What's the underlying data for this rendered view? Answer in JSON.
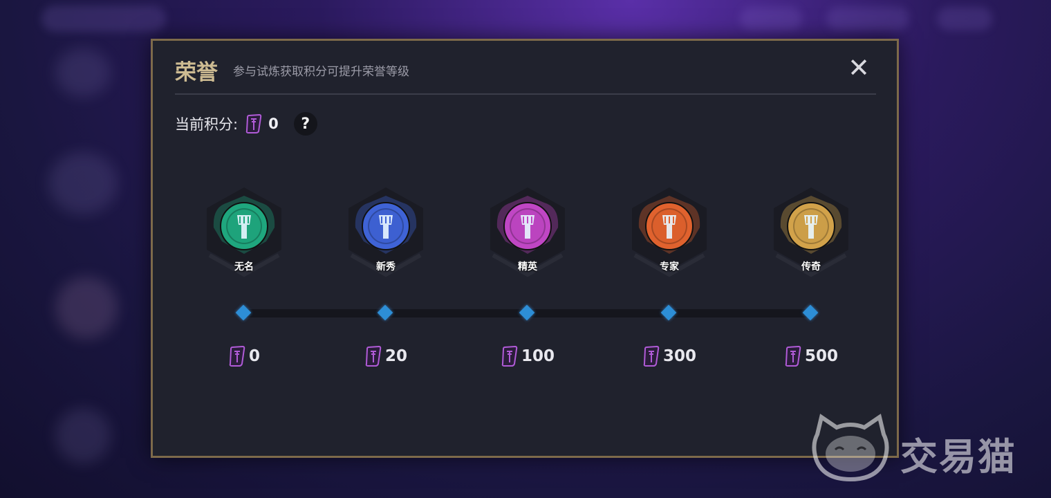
{
  "dialog": {
    "title": "荣誉",
    "subtitle": "参与试炼获取积分可提升荣誉等级",
    "close_icon": "close-icon"
  },
  "points": {
    "label": "当前积分:",
    "value": "0",
    "icon": "points-token-icon",
    "help_label": "?"
  },
  "tiers": [
    {
      "name": "无名",
      "cost": "0",
      "color": "#1fa77e"
    },
    {
      "name": "新秀",
      "cost": "20",
      "color": "#3f63d6"
    },
    {
      "name": "精英",
      "cost": "100",
      "color": "#c046c4"
    },
    {
      "name": "专家",
      "cost": "300",
      "color": "#e0622e"
    },
    {
      "name": "传奇",
      "cost": "500",
      "color": "#d2a24a"
    }
  ],
  "colors": {
    "accent_gold": "#cdbb92",
    "node_blue": "#2d8ed6",
    "token_purple": "#b15bd8"
  },
  "watermark": {
    "text": "交易猫"
  }
}
